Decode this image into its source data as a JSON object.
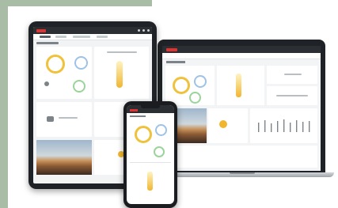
{
  "scene": {
    "description_role": "device-mockup",
    "devices": [
      "tablet",
      "laptop",
      "phone"
    ],
    "accent_color": "#e0332f",
    "frame_color": "#a9bca6",
    "icons": {
      "gauge": "gauge-icon",
      "bulb": "bulb-icon",
      "thermometer": "thermometer-icon"
    }
  }
}
